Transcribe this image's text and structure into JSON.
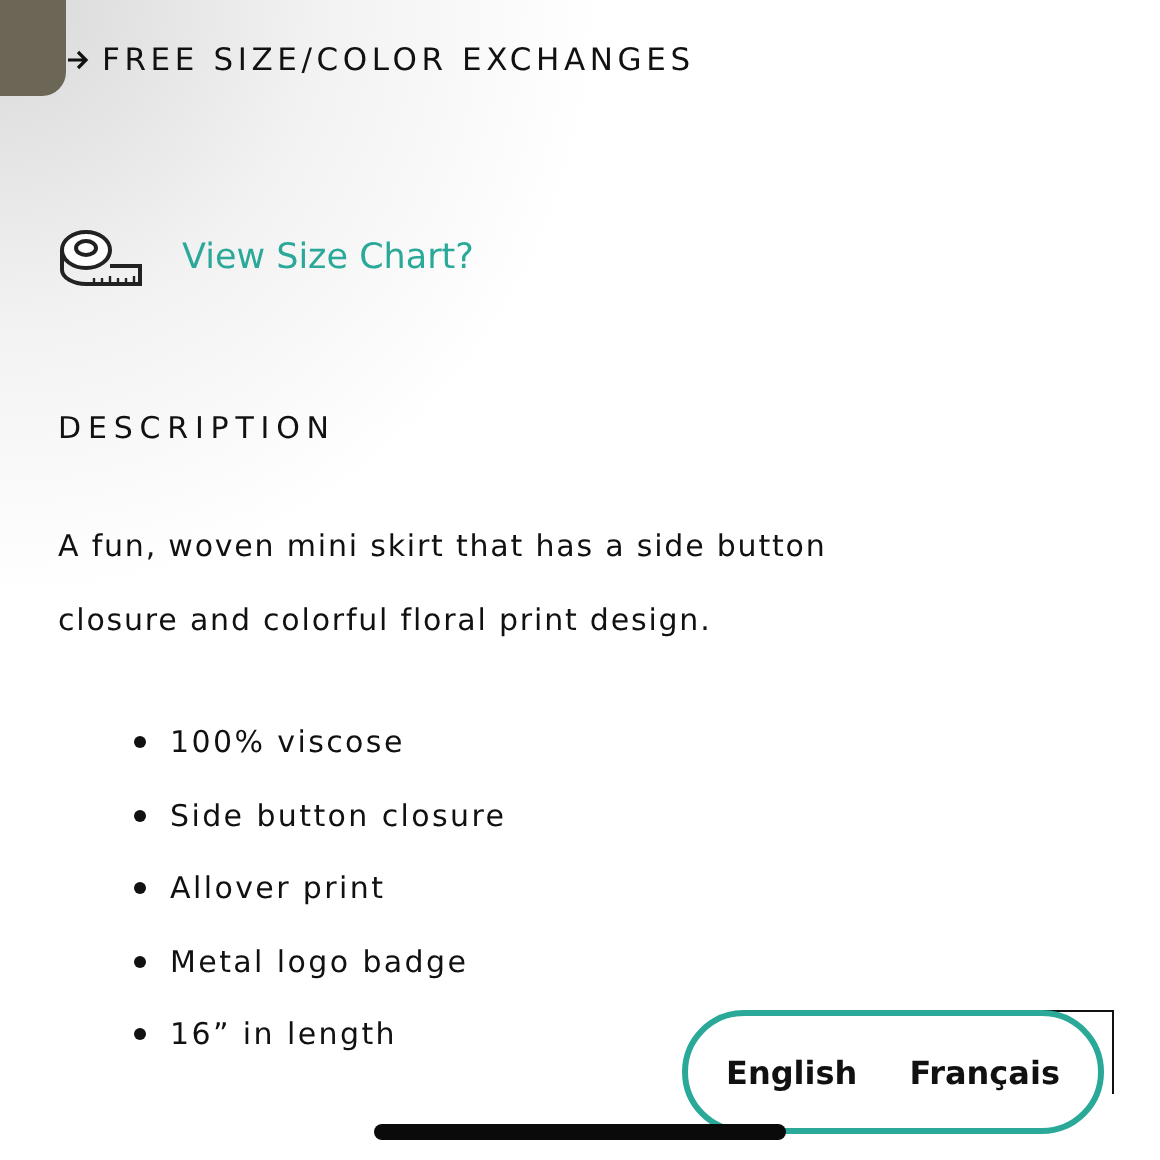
{
  "banner": {
    "text": "FREE SIZE/COLOR EXCHANGES"
  },
  "size_chart": {
    "link": "View Size Chart?"
  },
  "description": {
    "heading": "DESCRIPTION",
    "text": "A fun, woven mini skirt that has a side button closure and colorful floral print design.",
    "features": [
      "100% viscose",
      "Side button closure",
      "Allover print",
      "Metal logo badge",
      "16” in length"
    ]
  },
  "language_toggle": {
    "options": [
      "English",
      "Français"
    ]
  }
}
